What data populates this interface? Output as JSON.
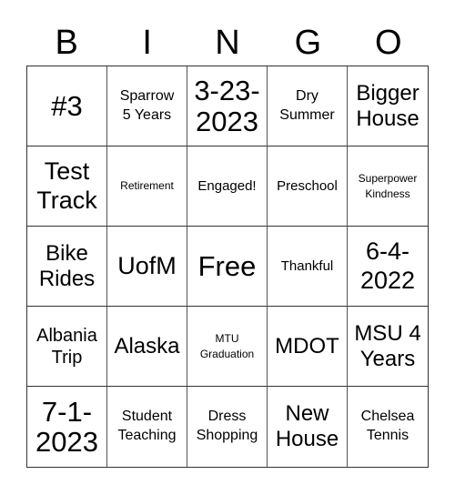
{
  "header": {
    "letters": [
      "B",
      "I",
      "N",
      "G",
      "O"
    ]
  },
  "board": {
    "cells": [
      {
        "text": "#3",
        "size": "s-xl"
      },
      {
        "text": "Sparrow\n5 Years",
        "size": "s-xs"
      },
      {
        "text": "3-23-\n2023",
        "size": "s-xl"
      },
      {
        "text": "Dry\nSummer",
        "size": "s-xs"
      },
      {
        "text": "Bigger\nHouse",
        "size": "s-m"
      },
      {
        "text": "Test\nTrack",
        "size": "s-l"
      },
      {
        "text": "Retirement",
        "size": "s-tiny"
      },
      {
        "text": "Engaged!",
        "size": "s-xxs"
      },
      {
        "text": "Preschool",
        "size": "s-xxs"
      },
      {
        "text": "Superpower\nKindness",
        "size": "s-tiny"
      },
      {
        "text": "Bike\nRides",
        "size": "s-m"
      },
      {
        "text": "UofM",
        "size": "s-l"
      },
      {
        "text": "Free",
        "size": "s-xl"
      },
      {
        "text": "Thankful",
        "size": "s-xxs"
      },
      {
        "text": "6-4-\n2022",
        "size": "s-l"
      },
      {
        "text": "Albania\nTrip",
        "size": "s-ms"
      },
      {
        "text": "Alaska",
        "size": "s-m"
      },
      {
        "text": "MTU\nGraduation",
        "size": "s-tiny"
      },
      {
        "text": "MDOT",
        "size": "s-m"
      },
      {
        "text": "MSU 4\nYears",
        "size": "s-m"
      },
      {
        "text": "7-1-\n2023",
        "size": "s-xl"
      },
      {
        "text": "Student\nTeaching",
        "size": "s-xs"
      },
      {
        "text": "Dress\nShopping",
        "size": "s-xs"
      },
      {
        "text": "New\nHouse",
        "size": "s-m"
      },
      {
        "text": "Chelsea\nTennis",
        "size": "s-xs"
      }
    ]
  }
}
